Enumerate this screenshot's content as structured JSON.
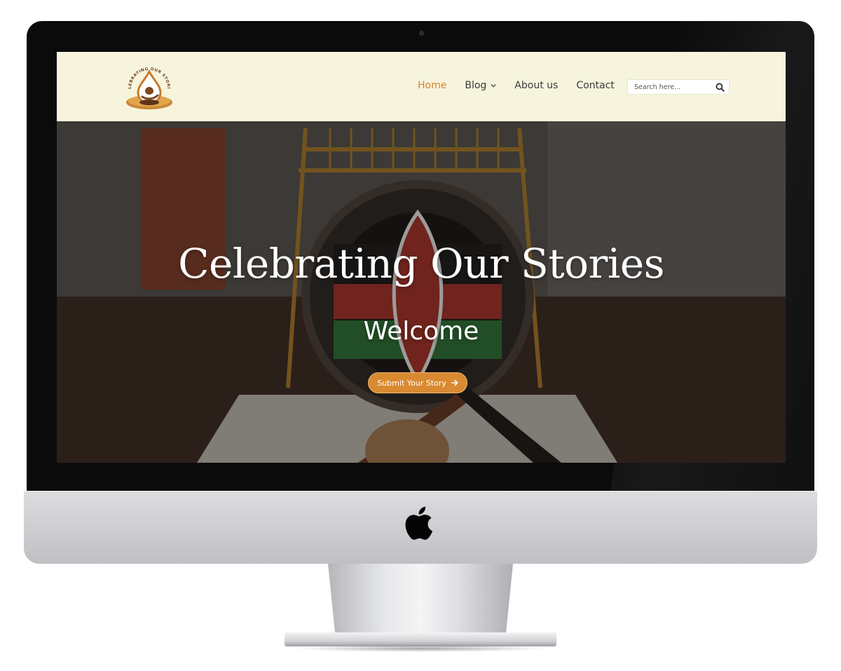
{
  "header": {
    "logo_text": "CELEBRATING OUR STORIES",
    "nav": [
      {
        "label": "Home",
        "active": true
      },
      {
        "label": "Blog",
        "has_dropdown": true
      },
      {
        "label": "About us"
      },
      {
        "label": "Contact"
      }
    ],
    "search": {
      "placeholder": "Search here...",
      "icon": "search-icon"
    }
  },
  "hero": {
    "title": "Celebrating Our Stories",
    "subtitle": "Welcome",
    "cta_label": "Submit Your Story",
    "cta_icon": "arrow-right-icon"
  },
  "colors": {
    "header_bg": "#f6f4dc",
    "accent": "#d98a31",
    "nav_active": "#d4842c",
    "nav_text": "#3a3a3a"
  },
  "device": {
    "logo_icon": "apple-logo"
  }
}
